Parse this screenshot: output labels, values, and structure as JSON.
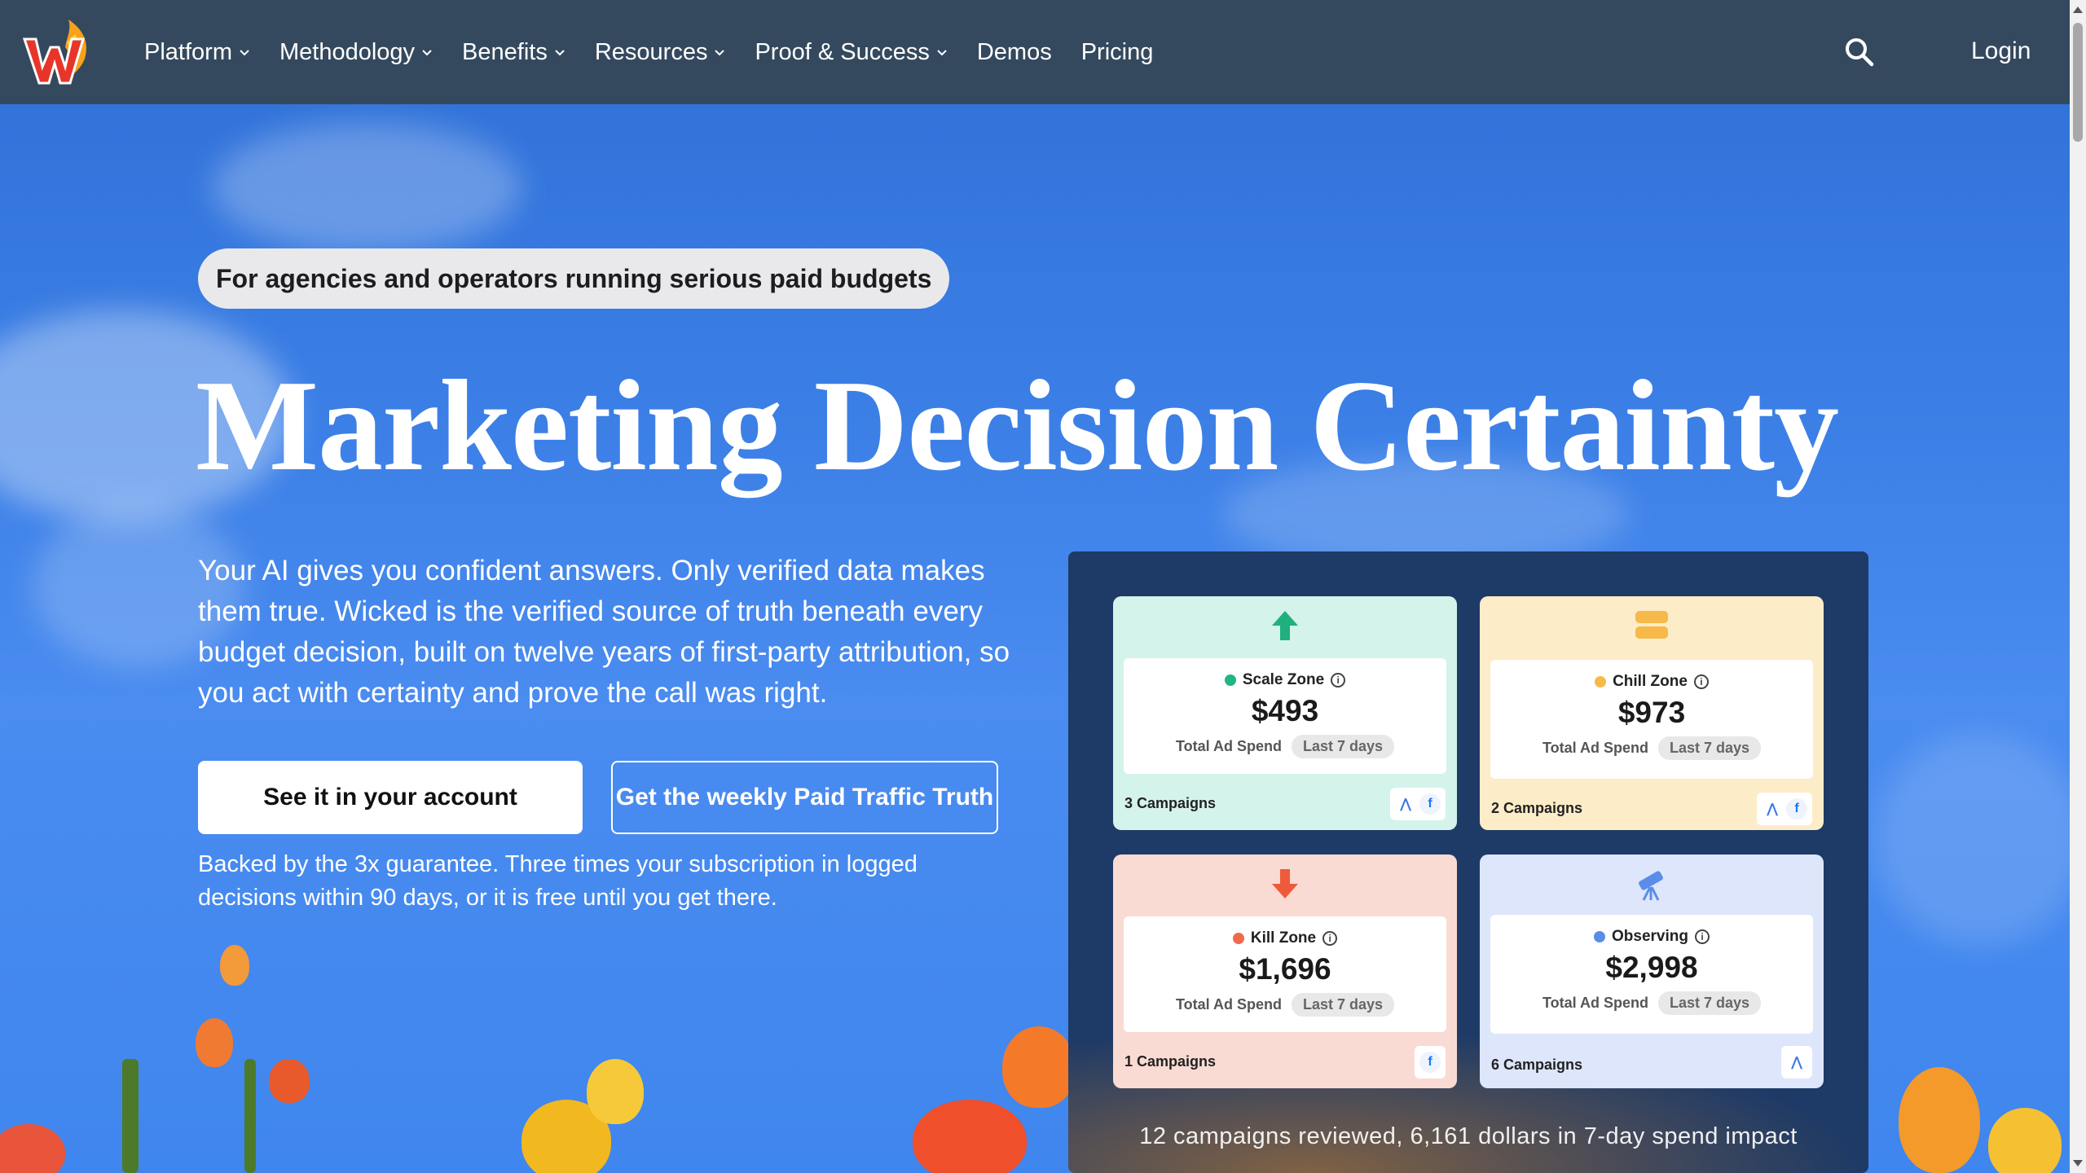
{
  "nav": {
    "logo_icon": "wicked-flame-logo",
    "items": [
      {
        "label": "Platform",
        "has_dropdown": true
      },
      {
        "label": "Methodology",
        "has_dropdown": true
      },
      {
        "label": "Benefits",
        "has_dropdown": true
      },
      {
        "label": "Resources",
        "has_dropdown": true
      },
      {
        "label": "Proof & Success",
        "has_dropdown": true
      },
      {
        "label": "Demos",
        "has_dropdown": false
      },
      {
        "label": "Pricing",
        "has_dropdown": false
      }
    ],
    "search_icon": "search-icon",
    "login_label": "Login"
  },
  "hero": {
    "pill": "For agencies and operators running serious paid budgets",
    "title": "Marketing Decision Certainty",
    "description": "Your AI gives you confident answers. Only verified data makes them true. Wicked is the verified source of truth beneath every budget decision, built on twelve years of first-party attribution, so you act with certainty and prove the call was right.",
    "primary_cta": "See it in your account",
    "secondary_cta": "Get the weekly Paid Traffic Truth",
    "guarantee": "Backed by the 3x guarantee. Three times your subscription in logged decisions within 90 days, or it is free until you get there."
  },
  "dashboard": {
    "cards": [
      {
        "zone": "Scale Zone",
        "amount": "$493",
        "spend_label": "Total Ad Spend",
        "period": "Last 7 days",
        "campaigns": "3 Campaigns",
        "platforms": [
          "google-ads",
          "facebook"
        ],
        "icon": "arrow-up-icon",
        "bg": "#d4f3ea",
        "dot": "#20b486"
      },
      {
        "zone": "Chill Zone",
        "amount": "$973",
        "spend_label": "Total Ad Spend",
        "period": "Last 7 days",
        "campaigns": "2 Campaigns",
        "platforms": [
          "google-ads",
          "facebook"
        ],
        "icon": "pause-icon",
        "bg": "#fdecc8",
        "dot": "#f6b94a"
      },
      {
        "zone": "Kill Zone",
        "amount": "$1,696",
        "spend_label": "Total Ad Spend",
        "period": "Last 7 days",
        "campaigns": "1 Campaigns",
        "platforms": [
          "facebook"
        ],
        "icon": "arrow-down-icon",
        "bg": "#fadbd3",
        "dot": "#ee6a4a"
      },
      {
        "zone": "Observing",
        "amount": "$2,998",
        "spend_label": "Total Ad Spend",
        "period": "Last 7 days",
        "campaigns": "6 Campaigns",
        "platforms": [
          "google-ads"
        ],
        "icon": "telescope-icon",
        "bg": "#dde6fb",
        "dot": "#5b8de8"
      }
    ],
    "footer": "12 campaigns reviewed, 6,161 dollars in 7-day spend impact"
  }
}
